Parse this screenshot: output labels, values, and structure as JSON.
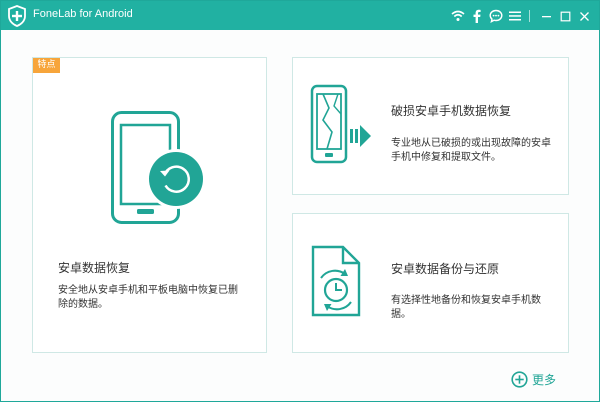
{
  "app": {
    "title": "FoneLab for Android",
    "accent": "#21b1a2",
    "badge_color": "#f7a53b",
    "titlebar_icons": [
      "wifi-icon",
      "facebook-icon",
      "chat-icon",
      "menu-icon",
      "minimize-icon",
      "maximize-icon",
      "close-icon"
    ]
  },
  "cards": {
    "main": {
      "badge": "特点",
      "title": "安卓数据恢复",
      "desc_line1": "安全地从安卓手机和平板电脑中恢复已删",
      "desc_line2": "除的数据。",
      "icon": "phone-restore-icon"
    },
    "broken": {
      "title": "破损安卓手机数据恢复",
      "desc_line1": "专业地从已破损的或出现故障的安卓",
      "desc_line2": "手机中修复和提取文件。",
      "icon": "broken-phone-icon"
    },
    "backup": {
      "title": "安卓数据备份与还原",
      "desc_line1": "有选择性地备份和恢复安卓手机数",
      "desc_line2": "据。",
      "icon": "backup-file-icon"
    }
  },
  "more": {
    "label": "更多",
    "icon": "plus-circle-icon"
  }
}
